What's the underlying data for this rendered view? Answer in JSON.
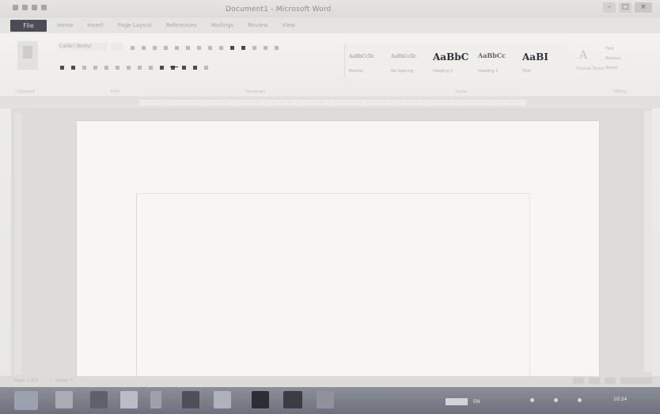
{
  "window": {
    "title": "Document1 - Microsoft Word",
    "minimize": "–",
    "maximize": "□",
    "close": "×"
  },
  "ribbon_tabs": {
    "file": "File",
    "tabs": [
      "Home",
      "Insert",
      "Page Layout",
      "References",
      "Mailings",
      "Review",
      "View"
    ]
  },
  "ribbon": {
    "font_name": "Calibri (Body)",
    "styles": [
      {
        "preview": "AaBbCcDc",
        "label": "Normal",
        "variant": "small"
      },
      {
        "preview": "AaBbCcDc",
        "label": "No Spacing",
        "variant": "small"
      },
      {
        "preview": "AaBbC",
        "label": "Heading 1",
        "variant": "big"
      },
      {
        "preview": "AaBbCc",
        "label": "Heading 2",
        "variant": "mid"
      },
      {
        "preview": "AaBI",
        "label": "Title",
        "variant": "big"
      }
    ],
    "change_styles": "Change Styles",
    "editing": [
      "Find",
      "Replace",
      "Select"
    ],
    "groups": [
      "Clipboard",
      "Font",
      "Paragraph",
      "Styles",
      "Editing"
    ]
  },
  "status": {
    "page": "Page: 1 of 1",
    "words": "Words: 0"
  },
  "taskbar": {
    "language": "EN",
    "clock": "10:24"
  },
  "colors": {
    "file_tab": "#4a4d55",
    "taskbar": "#7b808b"
  }
}
